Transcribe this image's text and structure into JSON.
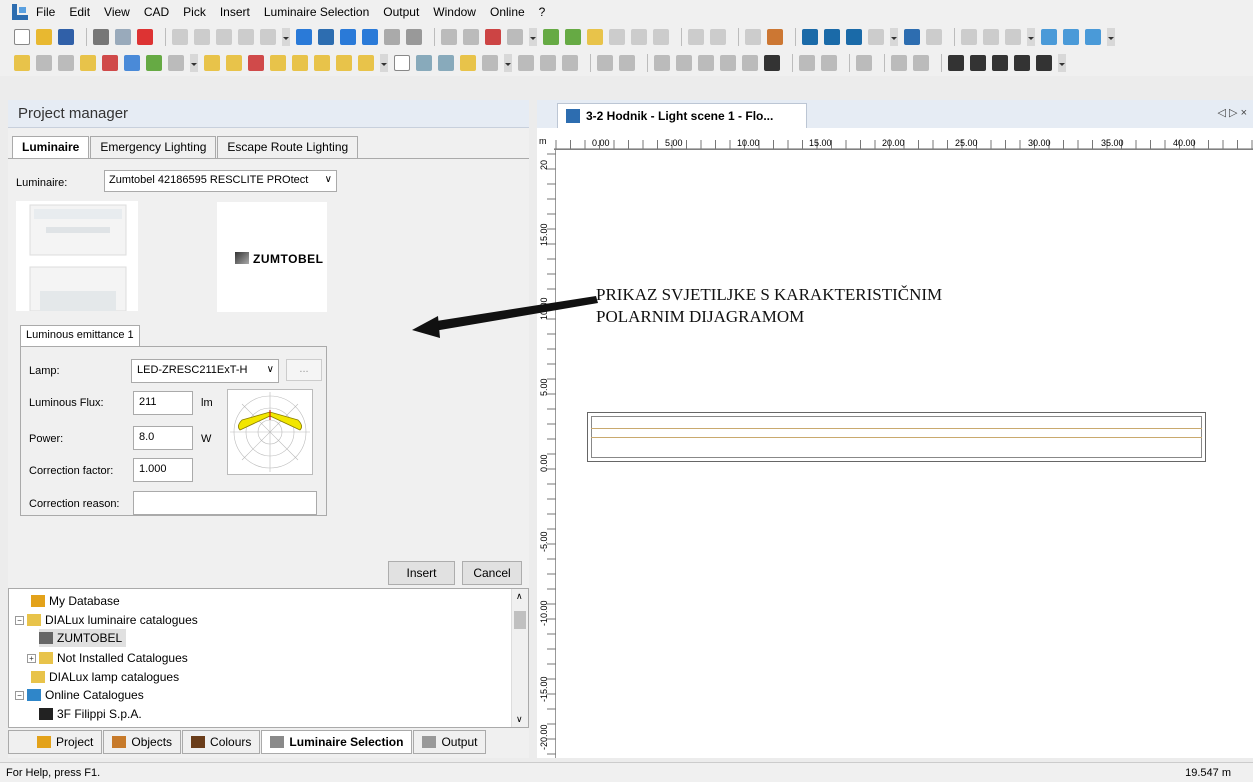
{
  "menu": [
    "File",
    "Edit",
    "View",
    "CAD",
    "Pick",
    "Insert",
    "Luminaire Selection",
    "Output",
    "Window",
    "Online",
    "?"
  ],
  "left_panel": {
    "title": "Project manager",
    "tabs": [
      "Luminaire",
      "Emergency Lighting",
      "Escape Route Lighting"
    ],
    "luminaire_label": "Luminaire:",
    "luminaire_value": "Zumtobel 42186595 RESCLITE PROtect",
    "logo_text": "ZUMTOBEL",
    "emittance_tab": "Luminous emittance 1",
    "fields": {
      "lamp_label": "Lamp:",
      "lamp_value": "LED-ZRESC211ExT-H",
      "lamp_more": "...",
      "flux_label": "Luminous Flux:",
      "flux_value": "211",
      "flux_unit": "lm",
      "power_label": "Power:",
      "power_value": "8.0",
      "power_unit": "W",
      "correction_label": "Correction factor:",
      "correction_value": "1.000",
      "reason_label": "Correction reason:",
      "reason_value": ""
    },
    "insert_button": "Insert",
    "cancel_button": "Cancel",
    "tree": [
      {
        "label": "My Database",
        "indent": 0,
        "icon": "database-icon",
        "color": "#e3a21a"
      },
      {
        "label": "DIALux luminaire catalogues",
        "indent": 0,
        "icon": "folder-icon",
        "color": "#e8c34a"
      },
      {
        "label": "ZUMTOBEL",
        "indent": 1,
        "icon": "zumtobel-icon",
        "color": "#666666"
      },
      {
        "label": "Not Installed Catalogues",
        "indent": 1,
        "icon": "folder-icon",
        "color": "#e8c34a"
      },
      {
        "label": "DIALux lamp catalogues",
        "indent": 0,
        "icon": "folder-icon",
        "color": "#e8c34a"
      },
      {
        "label": "Online Catalogues",
        "indent": 0,
        "icon": "globe-icon",
        "color": "#2f86c9"
      },
      {
        "label": "3F Filippi S.p.A.",
        "indent": 1,
        "icon": "filippi-icon",
        "color": "#222222"
      }
    ],
    "bottom_tabs": [
      "Project",
      "Objects",
      "Colours",
      "Luminaire Selection",
      "Output"
    ]
  },
  "document": {
    "tab_title": "3-2 Hodnik - Light scene 1 - Flo...",
    "nav": "◁ ▷ ×",
    "ruler_unit": "m",
    "ruler_top": [
      "0.00",
      "5.00",
      "10.00",
      "15.00",
      "20.00",
      "25.00",
      "30.00",
      "35.00",
      "40.00"
    ],
    "ruler_left": [
      "20",
      "15.00",
      "10.00",
      "5.00",
      "0.00",
      "-5.00",
      "-10.00",
      "-15.00",
      "-20.00"
    ],
    "annotation_line1": "PRIKAZ SVJETILJKE S KARAKTERISTIČNIM",
    "annotation_line2": "POLARNIM DIJAGRAMOM"
  },
  "status": {
    "left": "For Help, press F1.",
    "right": "19.547 m"
  },
  "colors": {
    "accent_blue": "#2d6db0",
    "polar_fill": "#f2e600",
    "corridor_lines": "#c9a96e"
  }
}
